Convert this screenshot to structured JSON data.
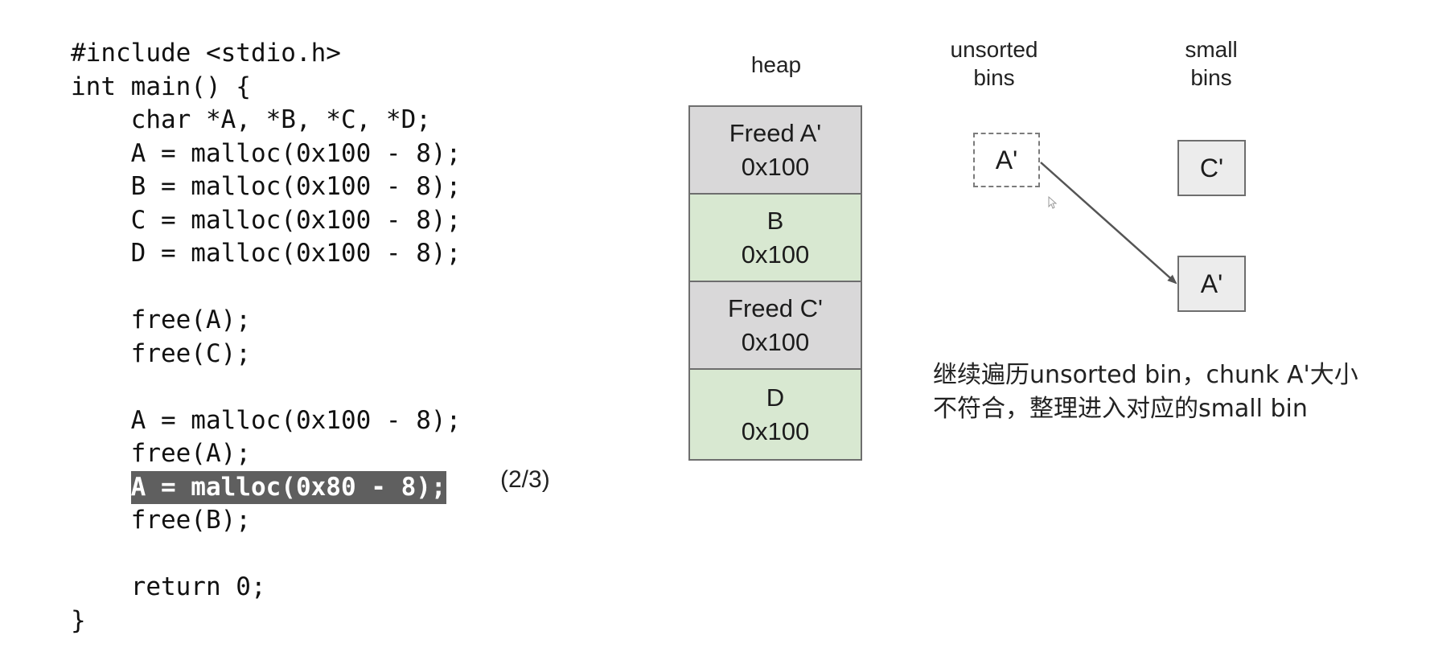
{
  "code_lines": [
    {
      "text": "#include <stdio.h>",
      "indent": 0,
      "highlighted": false
    },
    {
      "text": "int main() {",
      "indent": 0,
      "highlighted": false
    },
    {
      "text": "char *A, *B, *C, *D;",
      "indent": 1,
      "highlighted": false
    },
    {
      "text": "A = malloc(0x100 - 8);",
      "indent": 1,
      "highlighted": false
    },
    {
      "text": "B = malloc(0x100 - 8);",
      "indent": 1,
      "highlighted": false
    },
    {
      "text": "C = malloc(0x100 - 8);",
      "indent": 1,
      "highlighted": false
    },
    {
      "text": "D = malloc(0x100 - 8);",
      "indent": 1,
      "highlighted": false
    },
    {
      "text": "",
      "indent": 0,
      "highlighted": false
    },
    {
      "text": "free(A);",
      "indent": 1,
      "highlighted": false
    },
    {
      "text": "free(C);",
      "indent": 1,
      "highlighted": false
    },
    {
      "text": "",
      "indent": 0,
      "highlighted": false
    },
    {
      "text": "A = malloc(0x100 - 8);",
      "indent": 1,
      "highlighted": false
    },
    {
      "text": "free(A);",
      "indent": 1,
      "highlighted": false
    },
    {
      "text": "A = malloc(0x80 - 8);",
      "indent": 1,
      "highlighted": true
    },
    {
      "text": "free(B);",
      "indent": 1,
      "highlighted": false
    },
    {
      "text": "",
      "indent": 0,
      "highlighted": false
    },
    {
      "text": "return 0;",
      "indent": 1,
      "highlighted": false
    },
    {
      "text": "}",
      "indent": 0,
      "highlighted": false
    }
  ],
  "step_indicator": "(2/3)",
  "heap": {
    "title": "heap",
    "chunks": [
      {
        "label": "Freed A'",
        "size": "0x100",
        "state": "freed"
      },
      {
        "label": "B",
        "size": "0x100",
        "state": "used"
      },
      {
        "label": "Freed C'",
        "size": "0x100",
        "state": "freed"
      },
      {
        "label": "D",
        "size": "0x100",
        "state": "used"
      }
    ]
  },
  "unsorted_bins": {
    "title_line1": "unsorted",
    "title_line2": "bins",
    "entry": "A'"
  },
  "small_bins": {
    "title_line1": "small",
    "title_line2": "bins",
    "entries": [
      "C'",
      "A'"
    ]
  },
  "description": "继续遍历unsorted bin，chunk A'大小不符合，整理进入对应的small bin",
  "colors": {
    "freed_chunk": "#d9d8d9",
    "used_chunk": "#d8e8d1",
    "highlight_bg": "#5f5f5f",
    "arrow": "#555555"
  }
}
